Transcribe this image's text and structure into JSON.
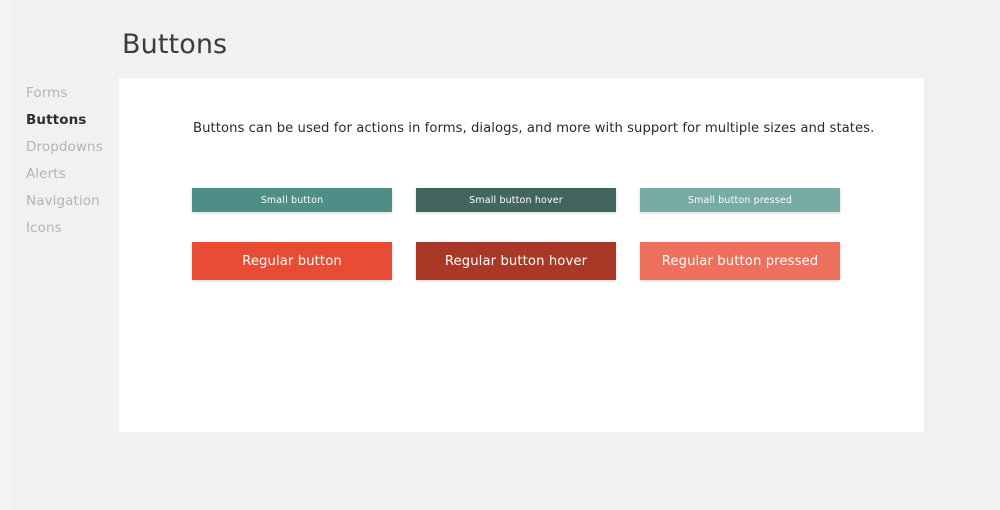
{
  "page": {
    "title": "Buttons",
    "background_color": "#f1f1f1",
    "card_background": "#ffffff"
  },
  "sidebar": {
    "items": [
      {
        "label": "Forms",
        "active": false
      },
      {
        "label": "Buttons",
        "active": true
      },
      {
        "label": "Dropdowns",
        "active": false
      },
      {
        "label": "Alerts",
        "active": false
      },
      {
        "label": "Navigation",
        "active": false
      },
      {
        "label": "Icons",
        "active": false
      }
    ]
  },
  "main": {
    "description": "Buttons can be used for actions in forms, dialogs, and more with support for multiple sizes and states.",
    "button_rows": [
      {
        "size": "small",
        "buttons": [
          {
            "label": "Small button",
            "state": "default",
            "color": "#4f8e86"
          },
          {
            "label": "Small button hover",
            "state": "hover",
            "color": "#42665f"
          },
          {
            "label": "Small button pressed",
            "state": "pressed",
            "color": "#78aba4"
          }
        ]
      },
      {
        "size": "regular",
        "buttons": [
          {
            "label": "Regular button",
            "state": "default",
            "color": "#e84c35"
          },
          {
            "label": "Regular button hover",
            "state": "hover",
            "color": "#a93826"
          },
          {
            "label": "Regular button pressed",
            "state": "pressed",
            "color": "#ee6f5c"
          }
        ]
      }
    ]
  }
}
